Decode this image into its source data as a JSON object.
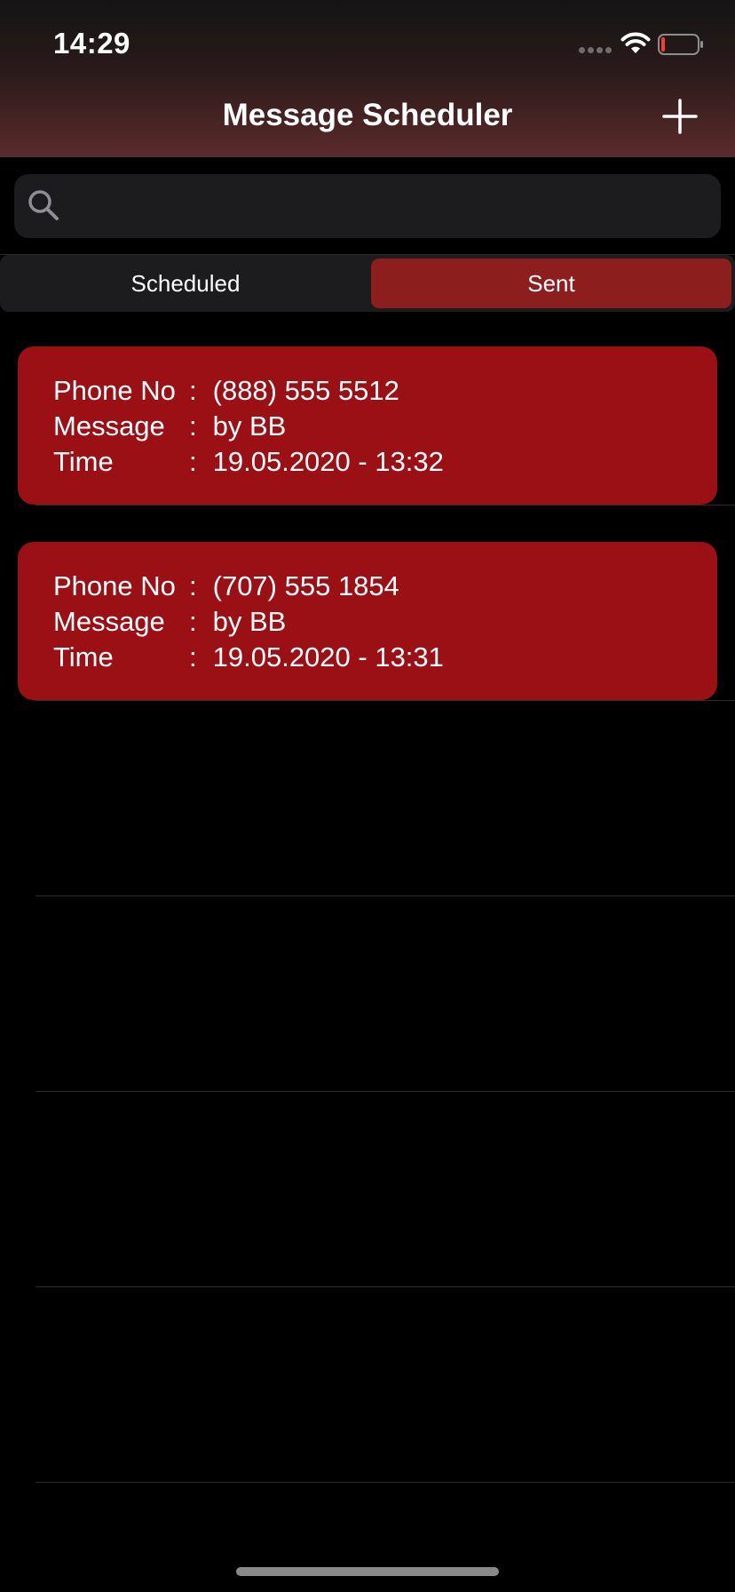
{
  "status_bar": {
    "time": "14:29",
    "icons": [
      "signal-dots-icon",
      "wifi-icon",
      "battery-low-icon"
    ]
  },
  "nav": {
    "title": "Message Scheduler",
    "add_icon": "plus-icon"
  },
  "search": {
    "value": "",
    "placeholder": "",
    "icon": "magnifier-icon"
  },
  "segments": {
    "items": [
      {
        "label": "Scheduled",
        "selected": false
      },
      {
        "label": "Sent",
        "selected": true
      }
    ]
  },
  "messages": [
    {
      "phone_label": "Phone No",
      "phone": "(888) 555 5512",
      "message_label": "Message",
      "message": "by BB",
      "time_label": "Time",
      "time": "19.05.2020 - 13:32"
    },
    {
      "phone_label": "Phone No",
      "phone": "(707) 555 1854",
      "message_label": "Message",
      "message": "by BB",
      "time_label": "Time",
      "time": "19.05.2020 - 13:31"
    }
  ],
  "colors": {
    "card_background": "#9b1015",
    "selected_segment": "#8c1e1e",
    "page_background": "#000000"
  }
}
